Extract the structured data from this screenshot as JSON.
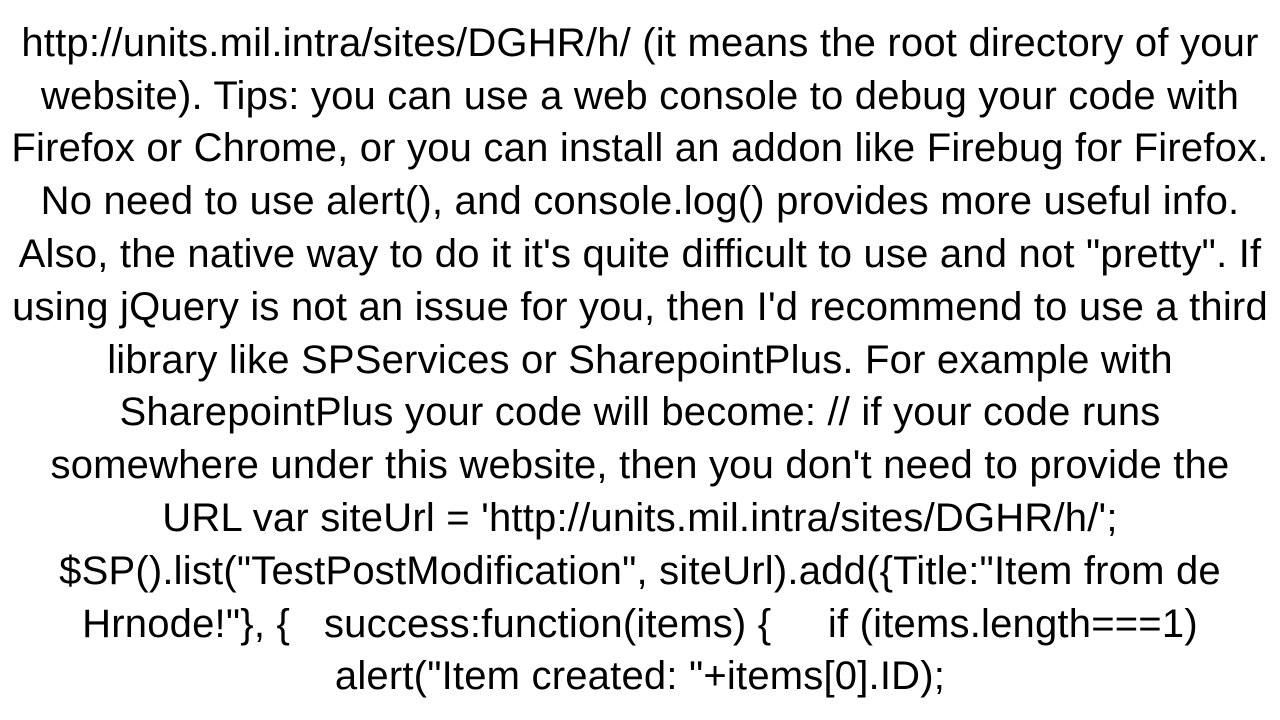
{
  "document": {
    "body_text": "http://units.mil.intra/sites/DGHR/h/ (it means the root directory of your website). Tips: you can use a web console to debug your code with Firefox or Chrome, or you can install an addon like Firebug for Firefox. No need to use alert(), and console.log() provides more useful info. Also, the native way to do it it's quite difficult to use and not \"pretty\". If using jQuery is not an issue for you, then I'd recommend to use a third library like SPServices or SharepointPlus. For example with SharepointPlus your code will become: // if your code runs somewhere under this website, then you don't need to provide the URL var siteUrl = 'http://units.mil.intra/sites/DGHR/h/'; $SP().list(\"TestPostModification\", siteUrl).add({Title:\"Item from de Hrnode!\"}, {   success:function(items) {     if (items.length===1) alert(\"Item created: \"+items[0].ID);"
  }
}
